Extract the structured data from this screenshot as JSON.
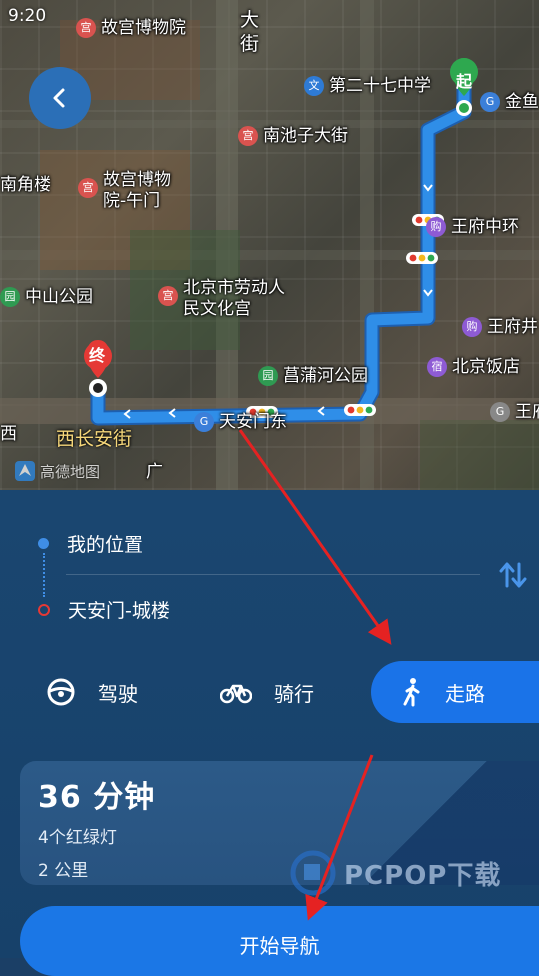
{
  "status": {
    "time": "9:20"
  },
  "map": {
    "pois": [
      {
        "id": "palace-museum",
        "label": "故宫博物院",
        "color": "#d9534f",
        "glyph": "宫"
      },
      {
        "id": "dajie",
        "label": "大街",
        "color": "",
        "glyph": ""
      },
      {
        "id": "school-27",
        "label": "第二十七中学",
        "color": "#2e7bd6",
        "glyph": "文"
      },
      {
        "id": "jinyu",
        "label": "金鱼",
        "color": "#3b7fd9",
        "glyph": "G"
      },
      {
        "id": "nanchizi",
        "label": "南池子大街",
        "color": "#d9534f",
        "glyph": "宫"
      },
      {
        "id": "nanjiaolou",
        "label": "南角楼",
        "color": "",
        "glyph": ""
      },
      {
        "id": "wumen",
        "label": "故宫博物院-午门",
        "color": "#d9534f",
        "glyph": "宫"
      },
      {
        "id": "wangfu-central",
        "label": "王府中环",
        "color": "#8e5bd4",
        "glyph": "购"
      },
      {
        "id": "zhongshan-park",
        "label": "中山公园",
        "color": "#2f9a52",
        "glyph": "园"
      },
      {
        "id": "workers-palace",
        "label": "北京市劳动人民文化宫",
        "color": "#d9534f",
        "glyph": "宫"
      },
      {
        "id": "wangfujing",
        "label": "王府井",
        "color": "#8e5bd4",
        "glyph": "购"
      },
      {
        "id": "beijing-hotel",
        "label": "北京饭店",
        "color": "#8e5bd4",
        "glyph": "宿"
      },
      {
        "id": "changpu-park",
        "label": "菖蒲河公园",
        "color": "#2f9a52",
        "glyph": "园"
      },
      {
        "id": "wang",
        "label": "王府",
        "color": "#888",
        "glyph": "G"
      },
      {
        "id": "tiananmen-east",
        "label": "天安门东",
        "color": "#3b7fd9",
        "glyph": "G"
      },
      {
        "id": "xi",
        "label": "西",
        "color": "",
        "glyph": ""
      }
    ],
    "start_marker": "起",
    "end_marker": "终",
    "road_label": "西长安街",
    "logo_text": "高德地图",
    "guang": "广"
  },
  "route": {
    "origin": "我的位置",
    "destination": "天安门-城楼"
  },
  "modes": [
    {
      "id": "drive",
      "label": "驾驶",
      "active": false
    },
    {
      "id": "ride",
      "label": "骑行",
      "active": false
    },
    {
      "id": "walk",
      "label": "走路",
      "active": true
    }
  ],
  "summary": {
    "duration": "36 分钟",
    "lights": "4个红绿灯",
    "distance": "2 公里"
  },
  "start_button": "开始导航",
  "watermark": "PCPOP下载",
  "colors": {
    "route": "#2f8ee8",
    "accent": "#1a73e8",
    "panel": "#17416a",
    "arrow": "#e52222"
  }
}
